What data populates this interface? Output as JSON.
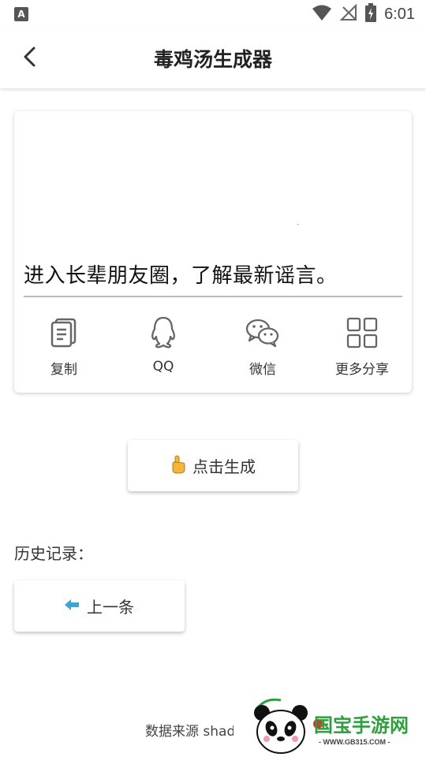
{
  "status_bar": {
    "left_icon": "A",
    "time": "6:01",
    "icons": [
      "wifi-icon",
      "no-signal-icon",
      "battery-charging-icon"
    ]
  },
  "header": {
    "title": "毒鸡汤生成器",
    "back_icon": "chevron-left-icon"
  },
  "quote": {
    "text": "进入长辈朋友圈，了解最新谣言。"
  },
  "share": {
    "items": [
      {
        "label": "复制",
        "icon": "copy-icon"
      },
      {
        "label": "QQ",
        "icon": "qq-penguin-icon"
      },
      {
        "label": "微信",
        "icon": "wechat-icon"
      },
      {
        "label": "更多分享",
        "icon": "grid-icon"
      }
    ]
  },
  "generate": {
    "label": "点击生成",
    "icon": "pointing-hand-icon"
  },
  "history": {
    "label": "历史记录：",
    "prev_label": "上一条",
    "prev_icon": "arrow-left-icon"
  },
  "footer": {
    "source": "数据来源 shad"
  },
  "watermark": {
    "brand": "国宝手游网",
    "url": "- WWW.GB315.COM -"
  },
  "colors": {
    "accent_blue": "#3aa6d8",
    "icon_gray": "#666666",
    "watermark_green": "#2e9e3e",
    "watermark_red": "#d6332c"
  }
}
